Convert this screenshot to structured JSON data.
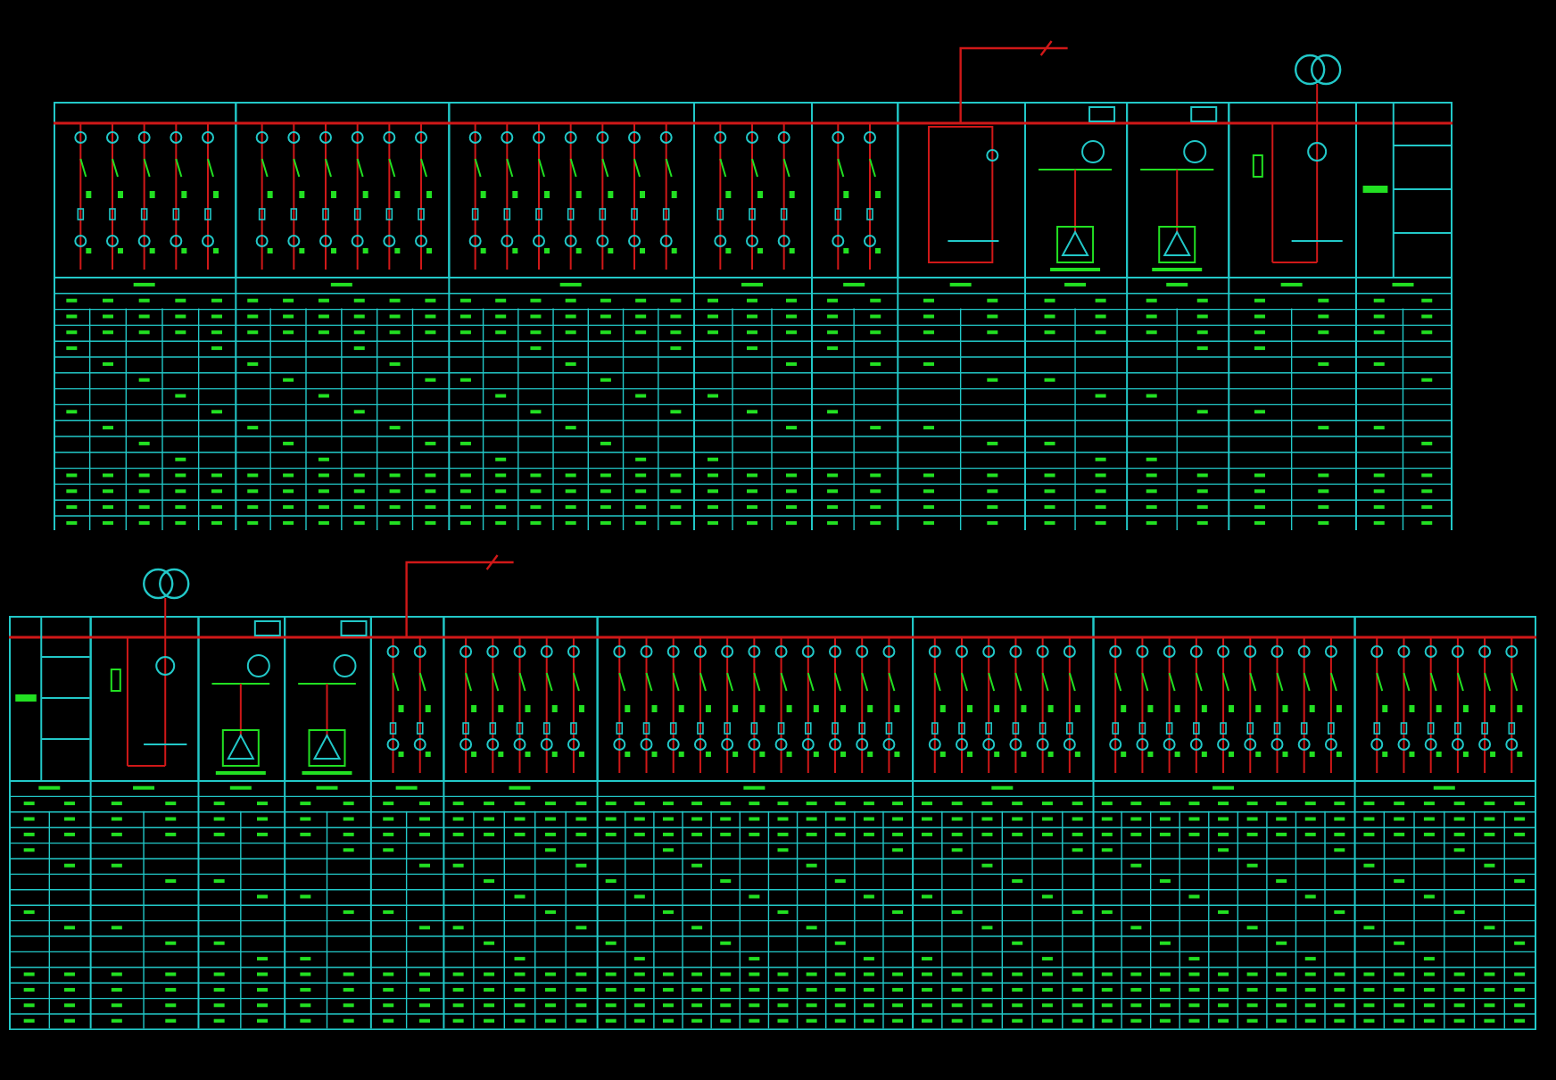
{
  "boards": [
    {
      "cabinets": [
        {
          "kind": "feeder",
          "riser": false,
          "circuits": [
            {
              "kind": "breaker"
            },
            {
              "kind": "breaker"
            },
            {
              "kind": "breaker"
            },
            {
              "kind": "breaker"
            },
            {
              "kind": "breaker"
            }
          ]
        },
        {
          "kind": "feeder",
          "riser": false,
          "circuits": [
            {
              "kind": "breaker"
            },
            {
              "kind": "breaker"
            },
            {
              "kind": "breaker"
            },
            {
              "kind": "breaker"
            },
            {
              "kind": "breaker"
            },
            {
              "kind": "breaker"
            }
          ]
        },
        {
          "kind": "feeder",
          "riser": false,
          "circuits": [
            {
              "kind": "breaker"
            },
            {
              "kind": "breaker"
            },
            {
              "kind": "breaker"
            },
            {
              "kind": "breaker"
            },
            {
              "kind": "breaker"
            },
            {
              "kind": "breaker"
            },
            {
              "kind": "breaker"
            }
          ]
        },
        {
          "kind": "feeder",
          "riser": false,
          "circuits": [
            {
              "kind": "breaker"
            },
            {
              "kind": "breaker"
            },
            {
              "kind": "breaker"
            }
          ]
        },
        {
          "kind": "feeder",
          "riser": false,
          "circuits": [
            {
              "kind": "breaker"
            },
            {
              "kind": "breaker"
            }
          ]
        },
        {
          "kind": "bus_tie",
          "riser": true
        },
        {
          "kind": "capacitor",
          "riser": false
        },
        {
          "kind": "capacitor",
          "riser": false
        },
        {
          "kind": "incoming",
          "riser": false
        },
        {
          "kind": "label",
          "riser": false
        }
      ]
    },
    {
      "cabinets": [
        {
          "kind": "label",
          "riser": false
        },
        {
          "kind": "incoming",
          "riser": false
        },
        {
          "kind": "capacitor",
          "riser": false
        },
        {
          "kind": "capacitor",
          "riser": false
        },
        {
          "kind": "feeder",
          "riser": true,
          "circuits": [
            {
              "kind": "breaker"
            },
            {
              "kind": "breaker"
            }
          ]
        },
        {
          "kind": "feeder",
          "riser": false,
          "circuits": [
            {
              "kind": "breaker"
            },
            {
              "kind": "breaker"
            },
            {
              "kind": "breaker"
            },
            {
              "kind": "breaker"
            },
            {
              "kind": "breaker"
            }
          ]
        },
        {
          "kind": "feeder",
          "riser": false,
          "circuits": [
            {
              "kind": "breaker"
            },
            {
              "kind": "breaker"
            },
            {
              "kind": "breaker"
            },
            {
              "kind": "breaker"
            },
            {
              "kind": "breaker"
            },
            {
              "kind": "breaker"
            },
            {
              "kind": "breaker"
            },
            {
              "kind": "breaker"
            },
            {
              "kind": "breaker"
            },
            {
              "kind": "breaker"
            },
            {
              "kind": "breaker"
            }
          ]
        },
        {
          "kind": "feeder",
          "riser": false,
          "circuits": [
            {
              "kind": "breaker"
            },
            {
              "kind": "breaker"
            },
            {
              "kind": "breaker"
            },
            {
              "kind": "breaker"
            },
            {
              "kind": "breaker"
            },
            {
              "kind": "breaker"
            }
          ]
        },
        {
          "kind": "feeder",
          "riser": false,
          "circuits": [
            {
              "kind": "breaker"
            },
            {
              "kind": "breaker"
            },
            {
              "kind": "breaker"
            },
            {
              "kind": "breaker"
            },
            {
              "kind": "breaker"
            },
            {
              "kind": "breaker"
            },
            {
              "kind": "breaker"
            },
            {
              "kind": "breaker"
            },
            {
              "kind": "breaker"
            }
          ]
        },
        {
          "kind": "feeder",
          "riser": false,
          "circuits": [
            {
              "kind": "breaker"
            },
            {
              "kind": "breaker"
            },
            {
              "kind": "breaker"
            },
            {
              "kind": "breaker"
            },
            {
              "kind": "breaker"
            },
            {
              "kind": "breaker"
            }
          ]
        }
      ]
    }
  ]
}
